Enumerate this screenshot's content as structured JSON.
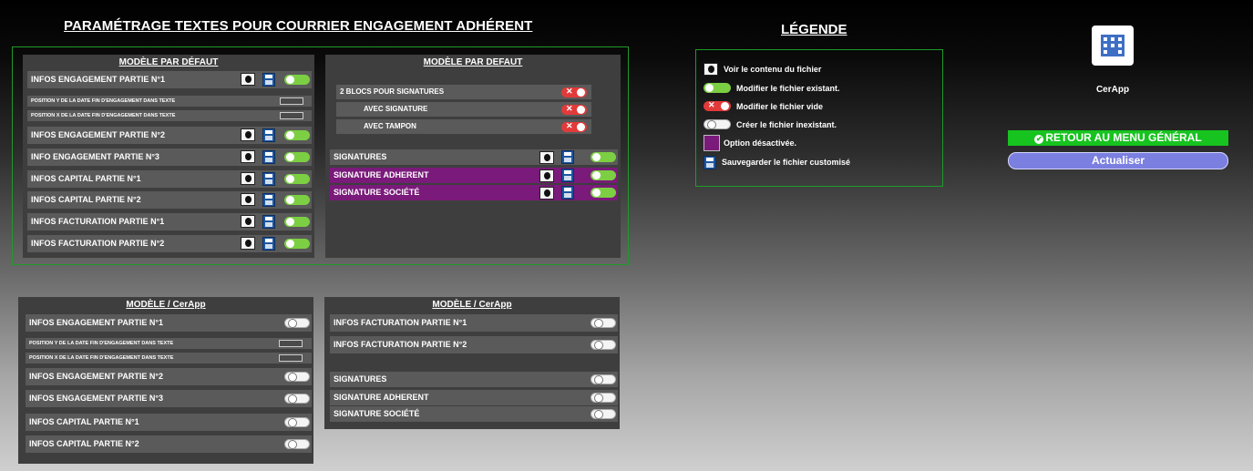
{
  "title": "PARAMÉTRAGE TEXTES POUR  COURRIER ENGAGEMENT ADHÉRENT",
  "legend": {
    "title": "LÉGENDE",
    "items": [
      {
        "icon": "eye-icon",
        "label": "Voir le contenu du fichier"
      },
      {
        "icon": "toggle-on-icon",
        "label": "Modifier le fichier existant."
      },
      {
        "icon": "toggle-red-icon",
        "label": "Modifier le fichier vide"
      },
      {
        "icon": "toggle-off-icon",
        "label": "Créer le fichier inexistant."
      },
      {
        "icon": "purple-square-icon",
        "label": "Option désactivée."
      },
      {
        "icon": "save-icon",
        "label": "Sauvegarder le fichier customisé"
      }
    ]
  },
  "app": {
    "label": "CerApp"
  },
  "buttons": {
    "retour": "RETOUR AU MENU GÉNÉRAL",
    "actualiser": "Actualiser"
  },
  "default_left": {
    "title": "MODÈLE PAR DÉFAUT",
    "rows": [
      "INFOS ENGAGEMENT PARTIE N°1",
      "POSITION Y DE LA DATE FIN D'ENGAGEMENT DANS TEXTE",
      "POSITION X DE LA DATE FIN D'ENGAGEMENT DANS TEXTE",
      "INFOS ENGAGEMENT PARTIE N°2",
      "INFO ENGAGEMENT PARTIE N°3",
      "INFOS CAPITAL PARTIE N°1",
      "INFOS CAPITAL PARTIE N°2",
      "INFOS FACTURATION PARTIE N°1",
      "INFOS FACTURATION PARTIE N°2"
    ]
  },
  "default_right": {
    "title": "MODÈLE PAR DEFAUT",
    "rows": [
      "2 BLOCS POUR SIGNATURES",
      "AVEC SIGNATURE",
      "AVEC TAMPON",
      "SIGNATURES",
      "SIGNATURE ADHERENT",
      "SIGNATURE SOCIÉTÉ"
    ]
  },
  "cerapp_left": {
    "title": "MODÈLE / CerApp",
    "rows": [
      "INFOS ENGAGEMENT PARTIE N°1",
      "POSITION Y DE LA DATE FIN D'ENGAGEMENT DANS TEXTE",
      "POSITION X DE LA DATE FIN D'ENGAGEMENT DANS TEXTE",
      "INFOS ENGAGEMENT  PARTIE N°2",
      "INFOS ENGAGEMENT PARTIE N°3",
      "INFOS CAPITAL PARTIE N°1",
      "INFOS CAPITAL PARTIE N°2"
    ]
  },
  "cerapp_right": {
    "title": "MODÈLE / CerApp",
    "rows": [
      "INFOS FACTURATION PARTIE N°1",
      "INFOS FACTURATION PARTIE N°2",
      "SIGNATURES",
      "SIGNATURE ADHERENT",
      "SIGNATURE SOCIÉTÉ"
    ]
  },
  "colors": {
    "green": "#17c31f",
    "toggle_on": "#7ccf43",
    "toggle_red": "#e23a3a",
    "disabled": "#7a1a7a",
    "actualiser": "#7b7fe0"
  }
}
